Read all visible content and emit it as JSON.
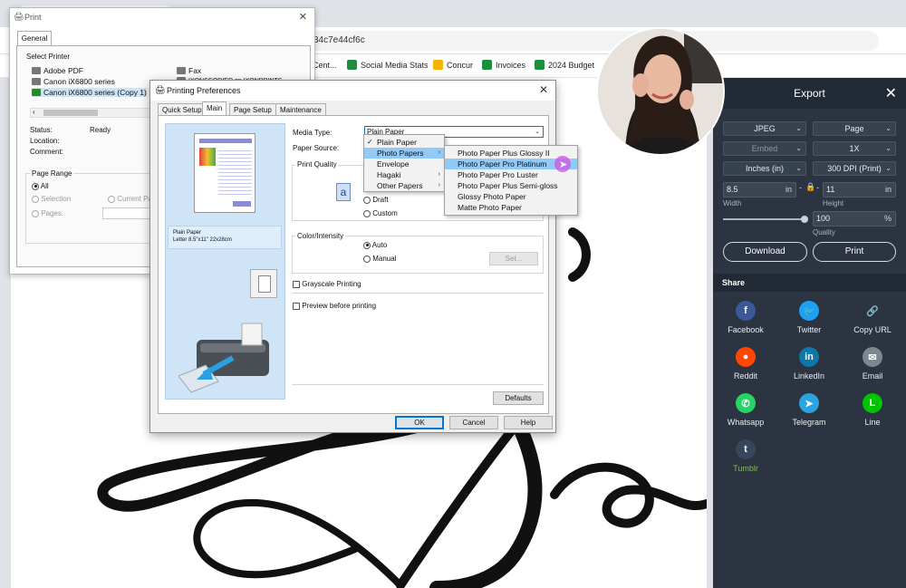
{
  "browser": {
    "url_fragment": "34c7e44cf6c",
    "bookmarks": [
      {
        "label": "Cent...",
        "color": "#7a7a7a"
      },
      {
        "label": "Social Media Stats",
        "color": "#1e8e3e"
      },
      {
        "label": "Concur",
        "color": "#f2b600"
      },
      {
        "label": "Invoices",
        "color": "#1e8e3e"
      },
      {
        "label": "2024 Budget",
        "color": "#1e8e3e"
      }
    ]
  },
  "print_dialog": {
    "title": "Print",
    "tab": "General",
    "select_printer_label": "Select Printer",
    "printers": [
      "Adobe PDF",
      "Canon iX6800 series",
      "Canon iX6800 series (Copy 1)",
      "Fax",
      "IXONSCORIER on IXONPRINTS"
    ],
    "status_label": "Status:",
    "status_value": "Ready",
    "location_label": "Location:",
    "comment_label": "Comment:",
    "page_range_label": "Page Range",
    "range_all": "All",
    "range_selection": "Selection",
    "range_current": "Current Page",
    "range_pages": "Pages:"
  },
  "prefs": {
    "title": "Printing Preferences",
    "tabs": [
      "Quick Setup",
      "Main",
      "Page Setup",
      "Maintenance"
    ],
    "active_tab": "Main",
    "media_type_label": "Media Type:",
    "media_type_value": "Plain Paper",
    "paper_source_label": "Paper Source:",
    "print_quality_label": "Print Quality",
    "quality_draft": "Draft",
    "quality_custom": "Custom",
    "color_intensity_label": "Color/Intensity",
    "color_auto": "Auto",
    "color_manual": "Manual",
    "set_button": "Set...",
    "grayscale_label": "Grayscale Printing",
    "preview_label": "Preview before printing",
    "preview_caption_1": "Plain Paper",
    "preview_caption_2": "Letter 8.5\"x11\" 22x28cm",
    "defaults_button": "Defaults",
    "ok_button": "OK",
    "cancel_button": "Cancel",
    "help_button": "Help"
  },
  "media_menu": {
    "items": [
      "Plain Paper",
      "Photo Papers",
      "Envelope",
      "Hagaki",
      "Other Papers"
    ],
    "checked": "Plain Paper",
    "highlighted": "Photo Papers"
  },
  "photo_submenu": {
    "items": [
      "Photo Paper Plus Glossy II",
      "Photo Paper Pro Platinum",
      "Photo Paper Pro Luster",
      "Photo Paper Plus Semi-gloss",
      "Glossy Photo Paper",
      "Matte Photo Paper"
    ],
    "highlighted": "Photo Paper Pro Platinum"
  },
  "export": {
    "title": "Export",
    "format": "JPEG",
    "page": "Page",
    "embed": "Embed",
    "scale": "1X",
    "units": "Inches (in)",
    "dpi": "300 DPI (Print)",
    "width_value": "8.5",
    "width_unit": "in",
    "height_value": "11",
    "height_unit": "in",
    "width_label": "Width",
    "height_label": "Height",
    "quality_value": "100",
    "quality_unit": "%",
    "quality_label": "Quality",
    "quality_fraction": 1.0,
    "download_button": "Download",
    "print_button": "Print",
    "share_title": "Share",
    "share_items": [
      {
        "label": "Facebook",
        "color": "#3b5998",
        "glyph": "f",
        "icon": "facebook-icon"
      },
      {
        "label": "Twitter",
        "color": "#1da1f2",
        "glyph": "🐦",
        "icon": "twitter-icon"
      },
      {
        "label": "Copy URL",
        "color": "#2b3440",
        "glyph": "🔗",
        "icon": "link-icon"
      },
      {
        "label": "Reddit",
        "color": "#ff4500",
        "glyph": "●",
        "icon": "reddit-icon"
      },
      {
        "label": "LinkedIn",
        "color": "#0e76a8",
        "glyph": "in",
        "icon": "linkedin-icon"
      },
      {
        "label": "Email",
        "color": "#7d8790",
        "glyph": "✉",
        "icon": "email-icon"
      },
      {
        "label": "Whatsapp",
        "color": "#25d366",
        "glyph": "✆",
        "icon": "whatsapp-icon"
      },
      {
        "label": "Telegram",
        "color": "#2aa3e0",
        "glyph": "➤",
        "icon": "telegram-icon"
      },
      {
        "label": "Line",
        "color": "#00c300",
        "glyph": "L",
        "icon": "line-icon"
      },
      {
        "label": "Tumblr",
        "color": "#36465d",
        "glyph": "t",
        "icon": "tumblr-icon"
      }
    ],
    "colors": {
      "panel": "#2b3440",
      "header": "#222b35",
      "tumblr_label": "#7dc242"
    }
  }
}
